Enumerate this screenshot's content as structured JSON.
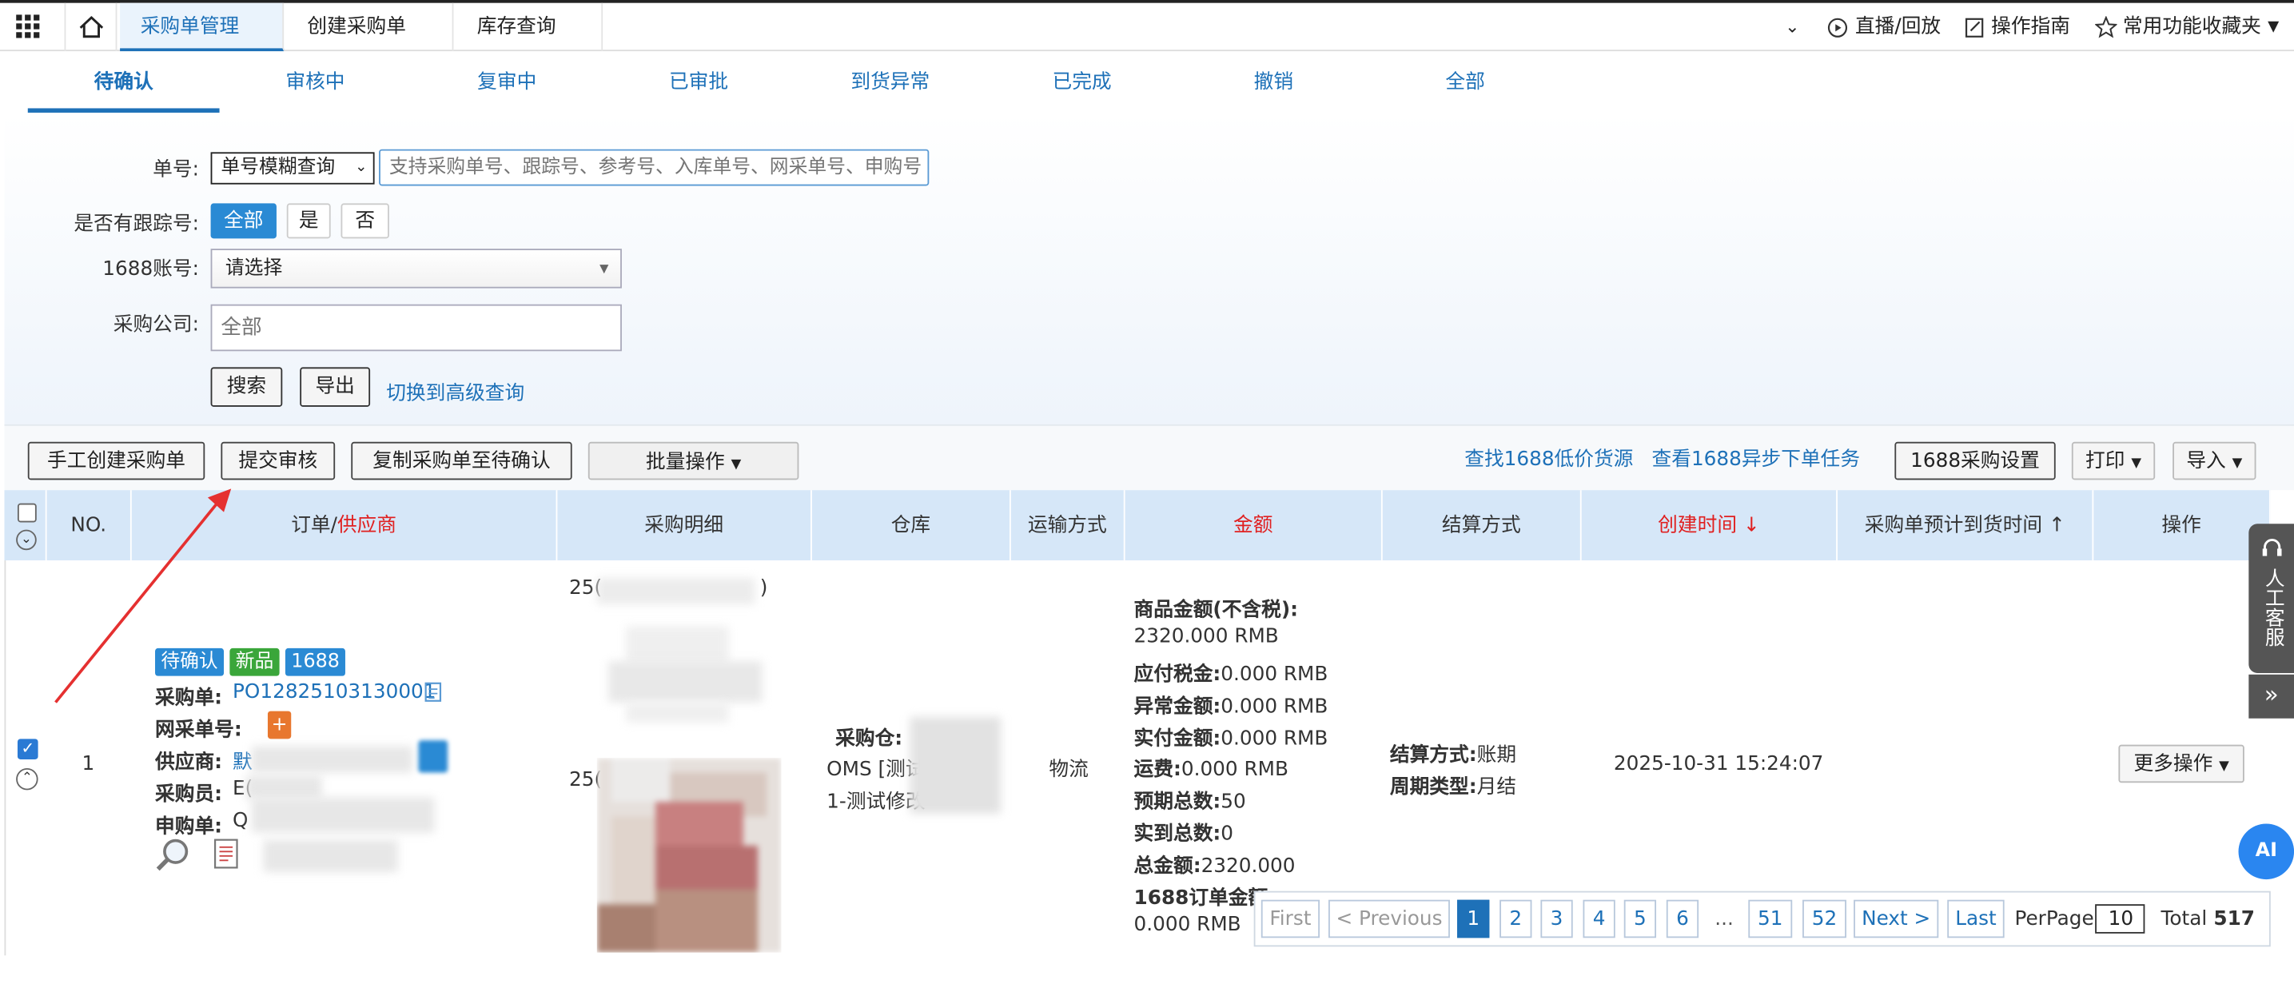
{
  "topbar": {
    "tabs": [
      "采购单管理",
      "创建采购单",
      "库存查询"
    ],
    "live": "直播/回放",
    "guide": "操作指南",
    "favorites": "常用功能收藏夹"
  },
  "status_tabs": [
    "待确认",
    "审核中",
    "复审中",
    "已审批",
    "到货异常",
    "已完成",
    "撤销",
    "全部"
  ],
  "filter": {
    "order_no_label": "单号:",
    "order_no_select": "单号模糊查询",
    "order_no_placeholder": "支持采购单号、跟踪号、参考号、入库单号、网采单号、申购号",
    "tracking_label": "是否有跟踪号:",
    "tracking_options": [
      "全部",
      "是",
      "否"
    ],
    "account_label": "1688账号:",
    "account_select": "请选择",
    "company_label": "采购公司:",
    "company_placeholder": "全部",
    "search": "搜索",
    "export": "导出",
    "advanced": "切换到高级查询"
  },
  "toolbar": {
    "manual_create": "手工创建采购单",
    "submit_review": "提交审核",
    "copy_to_pending": "复制采购单至待确认",
    "batch": "批量操作",
    "find_low_price": "查找1688低价货源",
    "view_async": "查看1688异步下单任务",
    "settings_1688": "1688采购设置",
    "print": "打印",
    "import": "导入"
  },
  "table": {
    "headers": {
      "no": "NO.",
      "order": "订单/",
      "supplier": "供应商",
      "detail": "采购明细",
      "warehouse": "仓库",
      "shipping": "运输方式",
      "amount": "金额",
      "settlement": "结算方式",
      "created": "创建时间 ↓",
      "eta": "采购单预计到货时间 ↑",
      "ops": "操作"
    },
    "row": {
      "no": "1",
      "tags": [
        "待确认",
        "新品",
        "1688"
      ],
      "po_label": "采购单:",
      "po_no": "PO12825103130001",
      "net_label": "网采单号:",
      "supplier_label": "供应商:",
      "supplier_val": "默",
      "buyer_label": "采购员:",
      "buyer_val": "E(",
      "req_label": "申购单:",
      "req_val": "Q",
      "detail1": "25(",
      "detail1b": ")",
      "detail2": "25(",
      "detail2b": ")",
      "wh_label": "采购仓:",
      "wh_val1": "OMS [测试",
      "wh_val2": "1-测试修改",
      "shipping": "物流",
      "amt": {
        "goods_label": "商品金额(不含税):",
        "goods_val": "2320.000  RMB",
        "tax_label": "应付税金:",
        "tax_val": "0.000  RMB",
        "abn_label": "异常金额:",
        "abn_val": "0.000  RMB",
        "paid_label": "实付金额:",
        "paid_val": "0.000  RMB",
        "freight_label": "运费:",
        "freight_val": "0.000  RMB",
        "exp_label": "预期总数:",
        "exp_val": "50",
        "real_label": "实到总数:",
        "real_val": "0",
        "total_label": "总金额:",
        "total_val": "2320.000",
        "o1688_label": "1688订单金额:",
        "o1688_val": "0.000  RMB"
      },
      "settle_label": "结算方式:",
      "settle_val": "账期",
      "period_label": "周期类型:",
      "period_val": "月结",
      "created": "2025-10-31 15:24:07",
      "more_ops": "更多操作"
    }
  },
  "pagination": {
    "first": "First",
    "prev": "< Previous",
    "pages": [
      "1",
      "2",
      "3",
      "4",
      "5",
      "6"
    ],
    "ellipsis": "...",
    "p51": "51",
    "p52": "52",
    "next": "Next >",
    "last": "Last",
    "perpage_label": "PerPage",
    "perpage": "10",
    "total_label": "Total",
    "total": "517"
  },
  "side": {
    "service": "人工客服",
    "ai": "AI",
    "expand": "»"
  }
}
